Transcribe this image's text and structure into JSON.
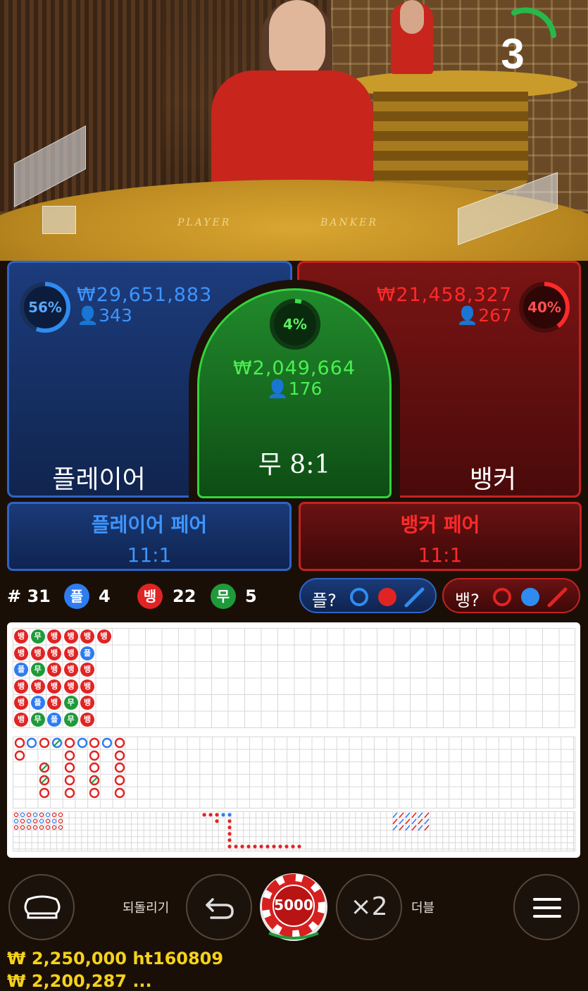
{
  "timer": {
    "seconds": "3"
  },
  "table_text": {
    "player": "PLAYER",
    "banker": "BANKER"
  },
  "player": {
    "percent": "56%",
    "amount": "₩29,651,883",
    "players": "343",
    "label": "플레이어"
  },
  "tie": {
    "percent": "4%",
    "amount": "₩2,049,664",
    "players": "176",
    "label": "무 8:1"
  },
  "banker": {
    "percent": "40%",
    "amount": "₩21,458,327",
    "players": "267",
    "label": "뱅커"
  },
  "player_pair": {
    "title": "플레이어 페어",
    "odds": "11:1"
  },
  "banker_pair": {
    "title": "뱅커 페어",
    "odds": "11:1"
  },
  "stats": {
    "round": "# 31",
    "player_badge": "플",
    "player_count": "4",
    "banker_badge": "뱅",
    "banker_count": "22",
    "tie_badge": "무",
    "tie_count": "5"
  },
  "predict": {
    "player_label": "플?",
    "banker_label": "뱅?"
  },
  "bead_plate": [
    [
      "뱅",
      "뱅",
      "플",
      "뱅",
      "뱅",
      "뱅"
    ],
    [
      "무",
      "뱅",
      "무",
      "뱅",
      "플",
      "무"
    ],
    [
      "뱅",
      "뱅",
      "뱅",
      "뱅",
      "뱅",
      "플"
    ],
    [
      "뱅",
      "뱅",
      "뱅",
      "뱅",
      "무",
      "무"
    ],
    [
      "뱅",
      "플",
      "뱅",
      "뱅",
      "뱅",
      "뱅"
    ],
    [
      "뱅"
    ]
  ],
  "controls": {
    "undo_label": "되돌리기",
    "chip_value": "5000",
    "double_label": "더블",
    "double_symbol": "×2"
  },
  "balance": {
    "text": "₩ 2,250,000 ht160809",
    "text2": "₩ 2,200,287 ..."
  },
  "colors": {
    "player": "#2e7cf0",
    "banker": "#e02424",
    "tie": "#1f9a3a",
    "accent": "#f5d21a"
  }
}
